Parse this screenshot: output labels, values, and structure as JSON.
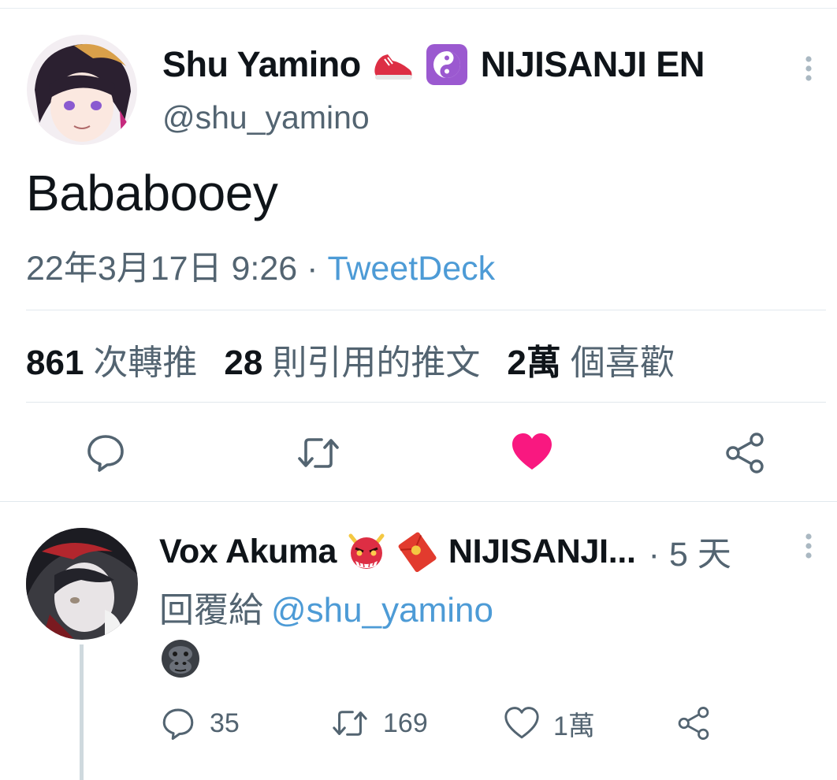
{
  "main_tweet": {
    "display_name": "Shu Yamino",
    "name_emojis": [
      "sneaker-emoji",
      "yin-yang-emoji"
    ],
    "name_suffix": "NIJISANJI EN",
    "handle": "@shu_yamino",
    "text": "Bababooey",
    "timestamp": "22年3月17日 9:26",
    "separator": " · ",
    "source": "TweetDeck",
    "stats": {
      "retweets_count": "861",
      "retweets_label": "次轉推",
      "quotes_count": "28",
      "quotes_label": "則引用的推文",
      "likes_count": "2萬",
      "likes_label": "個喜歡"
    },
    "actions": [
      "reply-icon",
      "retweet-icon",
      "like-icon",
      "share-icon"
    ],
    "liked": true
  },
  "reply": {
    "display_name": "Vox Akuma",
    "name_emojis": [
      "oni-mask-emoji",
      "red-envelope-emoji"
    ],
    "name_suffix": "NIJISANJI...",
    "separator": "·",
    "time_ago": "5 天",
    "replying_prefix": "回覆給",
    "replying_to": "@shu_yamino",
    "body_emoji": "gorilla-emoji",
    "actions": {
      "reply_count": "35",
      "retweet_count": "169",
      "like_count": "1萬"
    }
  },
  "colors": {
    "accent_link": "#4d9bd6",
    "like_pink": "#f91880",
    "secondary_text": "#536471",
    "divider": "#e1e8ed"
  }
}
